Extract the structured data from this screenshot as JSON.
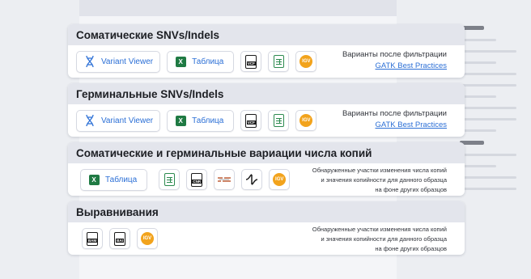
{
  "sections": [
    {
      "title": "Соматические SNVs/Indels",
      "buttons": {
        "viewer": "Variant Viewer",
        "table": "Таблица"
      },
      "note_line1": "Варианты после фильтрации",
      "note_link": "GATK Best Practices"
    },
    {
      "title": "Герминальные SNVs/Indels",
      "buttons": {
        "viewer": "Variant Viewer",
        "table": "Таблица"
      },
      "note_line1": "Варианты после фильтрации",
      "note_link": "GATK Best Practices"
    },
    {
      "title": "Соматические и герминальные вариации числа копий",
      "buttons": {
        "table": "Таблица"
      },
      "note_lines": [
        "Обнаруженные участки изменения числа копий",
        "и значения копийности для данного образца",
        "на фоне других образцов"
      ]
    },
    {
      "title": "Выравнивания",
      "note_lines": [
        "Обнаруженные участки изменения числа копий",
        "и значения копийности для данного образца",
        "на фоне других образцов"
      ]
    }
  ],
  "file_labels": {
    "vcf": "VCF",
    "cnr": "CNR",
    "bam": "BAM",
    "bai": "BAI",
    "igv": "IGV",
    "excel": "X"
  },
  "colors": {
    "accent": "#2b6fd6",
    "excel": "#1f7a43",
    "igv": "#f2a31c",
    "header_bg": "#e3e5ec"
  },
  "icons": [
    "dna-icon",
    "excel-icon",
    "vcf-file-icon",
    "spreadsheet-icon",
    "igv-icon",
    "cnr-file-icon",
    "segments-icon",
    "scatter-icon",
    "bam-file-icon",
    "bai-file-icon"
  ]
}
